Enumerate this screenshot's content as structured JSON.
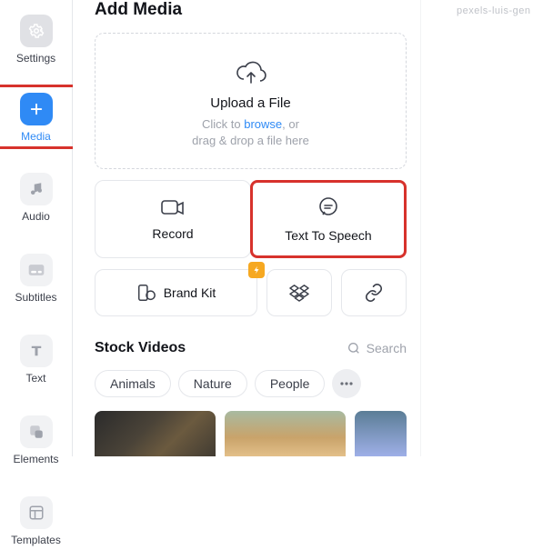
{
  "sidebar": {
    "settings": "Settings",
    "media": "Media",
    "audio": "Audio",
    "subtitles": "Subtitles",
    "text": "Text",
    "elements": "Elements",
    "templates": "Templates"
  },
  "main": {
    "title": "Add Media",
    "upload_label": "Upload a File",
    "upload_hint_1": "Click to ",
    "upload_browse": "browse",
    "upload_hint_2": ", or",
    "upload_hint_3": "drag & drop a file here",
    "record": "Record",
    "tts": "Text To Speech",
    "brandkit": "Brand Kit"
  },
  "stock": {
    "title": "Stock Videos",
    "search": "Search",
    "pills": [
      "Animals",
      "Nature",
      "People"
    ]
  },
  "right": {
    "text": "pexels-luis-gen"
  },
  "colors": {
    "accent": "#2f8af5",
    "highlight": "#d7322c",
    "badge": "#f6a821"
  }
}
